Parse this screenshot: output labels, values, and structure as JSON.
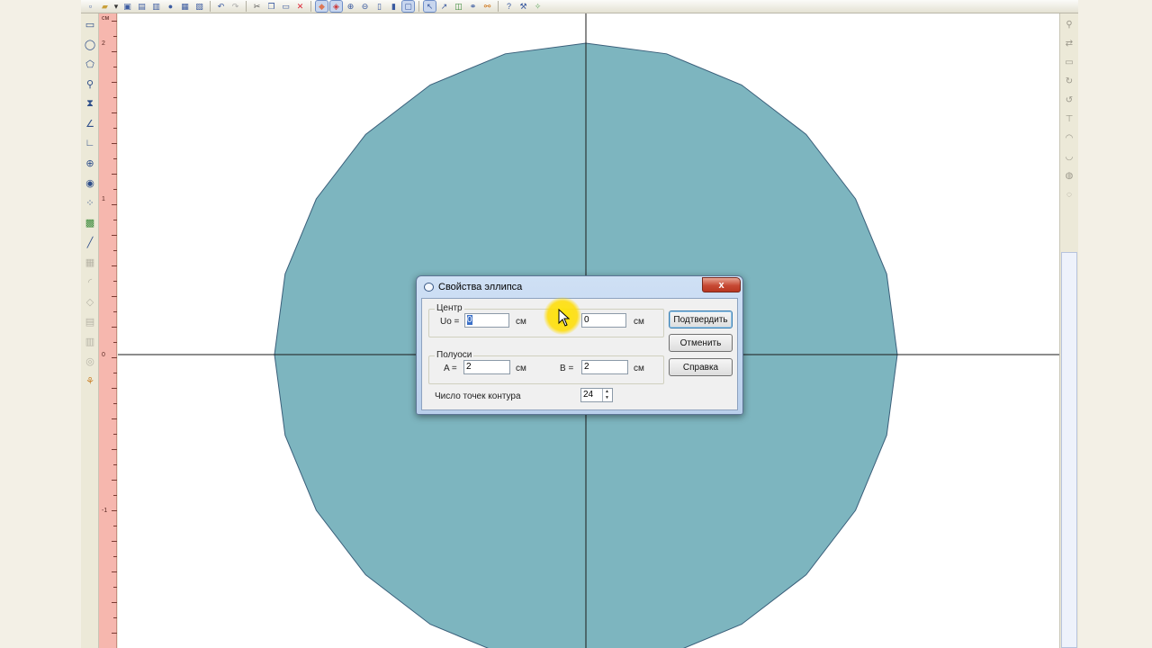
{
  "toolbar": {
    "icons": [
      "new-icon",
      "open-icon",
      "dropdown-icon",
      "save-icon",
      "save-as-icon",
      "export-icon",
      "globe-icon",
      "print-icon",
      "print-preview-icon",
      "undo-icon",
      "redo-icon",
      "cut-icon",
      "copy-icon",
      "paste-icon",
      "delete-icon",
      "layers-icon",
      "color-icon",
      "zoom-in-icon",
      "zoom-out-icon",
      "page-icon",
      "page-width-icon",
      "fit-icon",
      "select-icon",
      "node-icon",
      "group-icon",
      "bind-icon",
      "link-icon",
      "help-icon",
      "tools-icon",
      "magic-icon"
    ]
  },
  "ruler": {
    "unit": "см",
    "labels": [
      "2",
      "1",
      "0",
      "-1"
    ]
  },
  "drawing": {
    "fill_color": "#7db5bf",
    "stroke_color": "#3a5f7a",
    "contour_points": 24,
    "center_u": 0,
    "center_v": 0,
    "semi_axis_a": 2,
    "semi_axis_b": 2
  },
  "dialog": {
    "title": "Свойства эллипса",
    "close_label": "x",
    "center_group": "Центр",
    "u_label": "Uo =",
    "u_value": "0",
    "u_unit": "см",
    "v_label": "V",
    "v_value": "0",
    "v_unit": "см",
    "axes_group": "Полуоси",
    "a_label": "A =",
    "a_value": "2",
    "a_unit": "см",
    "b_label": "B =",
    "b_value": "2",
    "b_unit": "см",
    "points_label": "Число точек контура",
    "points_value": "24",
    "confirm_label": "Подтвердить",
    "cancel_label": "Отменить",
    "help_label": "Справка"
  }
}
